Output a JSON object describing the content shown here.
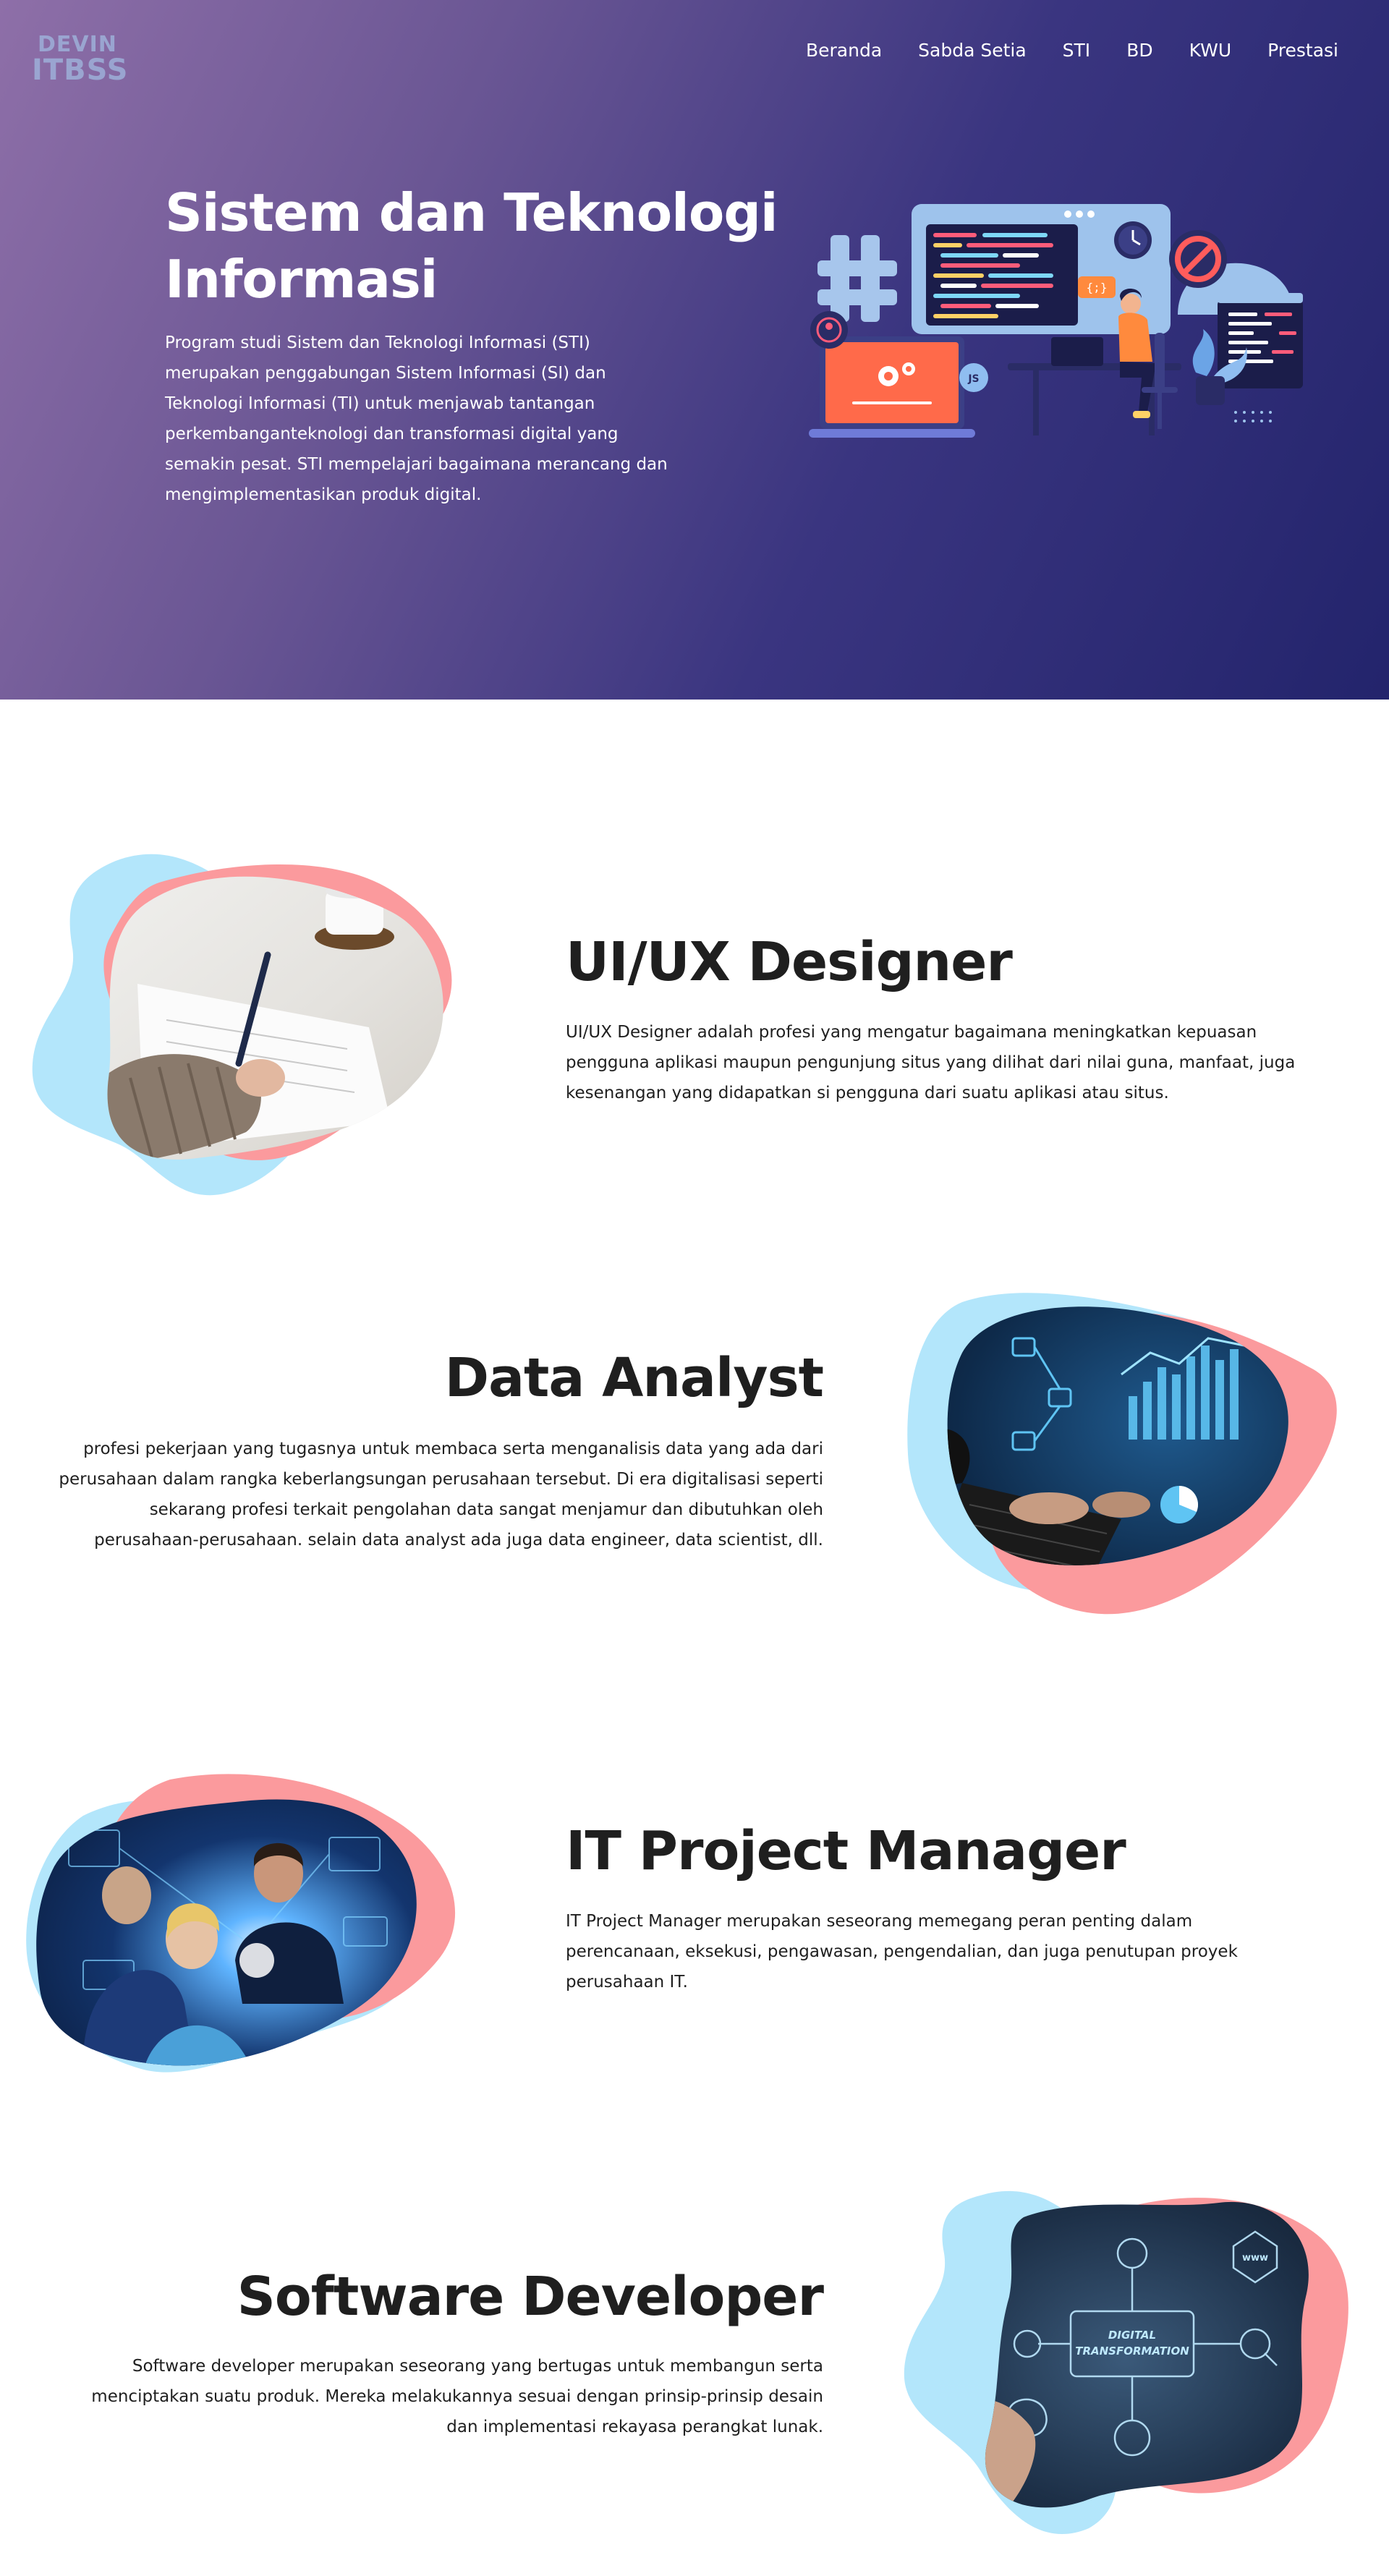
{
  "brand": {
    "logo_top": "DEVIN",
    "logo_bottom": "ITBSS"
  },
  "nav": {
    "items": [
      "Beranda",
      "Sabda Setia",
      "STI",
      "BD",
      "KWU",
      "Prestasi"
    ]
  },
  "hero": {
    "title": "Sistem dan Teknologi Informasi",
    "description": "Program studi Sistem dan Teknologi Informasi (STI) merupakan penggabungan Sistem Informasi (SI) dan Teknologi Informasi (TI) untuk menjawab tantangan perkembanganteknologi dan transformasi digital yang semakin pesat. STI mempelajari bagaimana merancang dan mengimplementasikan produk digital.",
    "illustration_labels": {
      "code_badge": "{;}",
      "js_badge": "JS"
    }
  },
  "sections": [
    {
      "title": "UI/UX Designer",
      "description": "UI/UX Designer adalah profesi yang mengatur bagaimana meningkatkan kepuasan pengguna aplikasi maupun pengunjung situs yang dilihat dari nilai guna, manfaat, juga kesenangan yang didapatkan si pengguna dari suatu aplikasi atau situs.",
      "image": "writing-hand-photo"
    },
    {
      "title": "Data Analyst",
      "description": "profesi pekerjaan yang tugasnya untuk membaca serta menganalisis data yang ada dari perusahaan dalam rangka keberlangsungan perusahaan tersebut. Di era digitalisasi seperti sekarang profesi terkait pengolahan data sangat menjamur dan dibutuhkan oleh perusahaan-perusahaan. selain data analyst ada juga data engineer, data scientist, dll.",
      "image": "laptop-analytics-photo"
    },
    {
      "title": "IT Project Manager",
      "description": "IT Project Manager merupakan seseorang memegang peran penting dalam perencanaan, eksekusi, pengawasan, pengendalian, dan juga penutupan proyek perusahaan IT.",
      "image": "team-hologram-photo"
    },
    {
      "title": "Software Developer",
      "description": "Software developer merupakan seseorang yang bertugas untuk membangun serta menciptakan suatu produk. Mereka melakukannya sesuai dengan prinsip-prinsip desain dan implementasi rekayasa perangkat lunak.",
      "image": "digital-transformation-photo",
      "image_caption": "DIGITAL TRANSFORMATION"
    }
  ],
  "colors": {
    "hero_gradient_start": "#8e6fa8",
    "hero_gradient_end": "#23246c",
    "blob_blue": "#b3e6fb",
    "blob_pink": "#fb9a9d",
    "text_dark": "#1f1f1f",
    "text_light": "#ffffff"
  }
}
